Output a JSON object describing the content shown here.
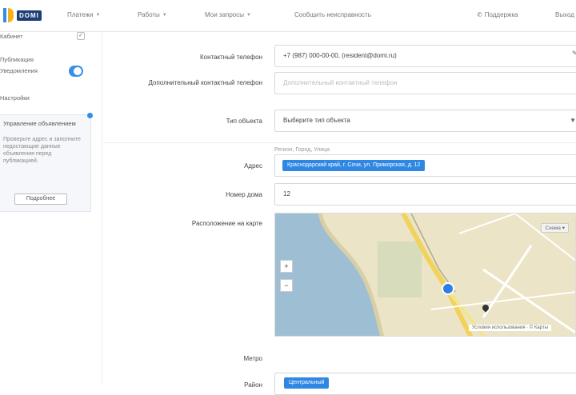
{
  "brand": {
    "name": "DOMI"
  },
  "nav": {
    "items": [
      "Платежи",
      "Работы",
      "Мои запросы",
      "Сообщить неисправность"
    ],
    "right_items": [
      "Поддержка",
      "Выход"
    ]
  },
  "sidebar": {
    "items": [
      {
        "label": "Кабинет"
      },
      {
        "label": "Публикация"
      },
      {
        "label": "Уведомления"
      },
      {
        "label": "Настройки"
      }
    ],
    "card": {
      "title": "Управление объявлением",
      "body": "Проверьте адрес и заполните недостающие данные объявления перед публикацией.",
      "button": "Подробнее"
    }
  },
  "form": {
    "rows": [
      {
        "label": "Контактный телефон",
        "value": "+7 (987) 000-00-00, (resident@domi.ru)",
        "placeholder": false
      },
      {
        "label": "Дополнительный контактный телефон",
        "value": "Дополнительный контактный телефон",
        "placeholder": true
      },
      {
        "label": "Тип объекта",
        "value": "Выберите тип объекта",
        "placeholder": false,
        "select": true
      }
    ],
    "address": {
      "hint": "Регион, Город, Улица",
      "label": "Адрес",
      "tag": "Краснодарский край, г. Сочи, ул. Приморская, д. 12"
    },
    "house": {
      "label": "Номер дома",
      "value": "12"
    },
    "map": {
      "label": "Расположение на карте",
      "switch": "Схема",
      "attribution": "Условия использования · © Карты"
    },
    "metro": {
      "label": "Метро"
    },
    "district": {
      "label": "Район",
      "tag": "Центральный"
    }
  }
}
